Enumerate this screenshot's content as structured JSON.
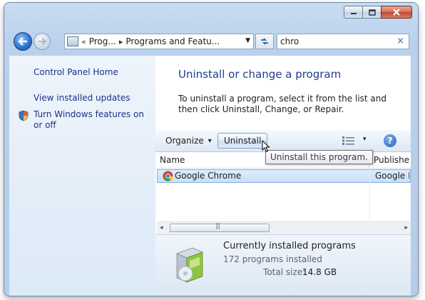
{
  "window": {
    "controls": {
      "minimize_icon": "minimize-icon",
      "maximize_icon": "maximize-icon",
      "close_icon": "close-icon"
    }
  },
  "nav": {
    "address": {
      "overflow": "«",
      "crumb1": "Prog...",
      "sep": "▸",
      "crumb2": "Programs and Featu..."
    },
    "search": {
      "value": "chro",
      "clear": "×"
    }
  },
  "sidebar": {
    "home": "Control Panel Home",
    "updates": "View installed updates",
    "features": "Turn Windows features on or off"
  },
  "main": {
    "heading": "Uninstall or change a program",
    "description": "To uninstall a program, select it from the list and then click Uninstall, Change, or Repair."
  },
  "toolbar": {
    "organize": "Organize",
    "organize_arrow": "▾",
    "uninstall": "Uninstall",
    "views_arrow": "▾",
    "help": "?"
  },
  "tooltip": {
    "text": "Uninstall this program."
  },
  "list": {
    "columns": [
      {
        "label": "Name"
      },
      {
        "label": "Publishe"
      }
    ],
    "rows": [
      {
        "name": "Google Chrome",
        "publisher": "Google I"
      }
    ]
  },
  "scrollbar": {
    "left": "◂",
    "right": "▸",
    "grip": "|||"
  },
  "details": {
    "title": "Currently installed programs",
    "count": "172 programs installed",
    "size_label": "Total size:",
    "size_value": "14.8 GB"
  },
  "colors": {
    "link": "#1e3287",
    "heading": "#1e3d8f",
    "selection": "#c9e0f8"
  }
}
